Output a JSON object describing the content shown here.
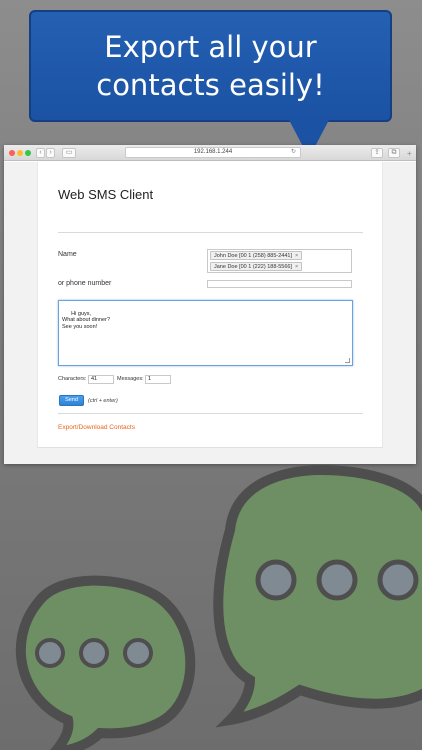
{
  "banner": {
    "line1": "Export all your",
    "line2": "contacts easily!"
  },
  "browser": {
    "url": "192.168.1.244"
  },
  "app": {
    "title": "Web SMS Client",
    "name_label": "Name",
    "recipients": [
      "John Doe [00 1 (258) 885-2441]",
      "Jane Doe [00 1 (222) 188-5566]"
    ],
    "remove_symbol": "×",
    "phone_label": "or phone number",
    "phone_value": "",
    "message": "Hi guys,\nWhat about dinner?\nSee you soon!",
    "characters_label": "Characters:",
    "characters_value": "41",
    "messages_label": "Messages:",
    "messages_value": "1",
    "send_label": "Send",
    "send_hint": "(ctrl + enter)",
    "export_label": "Export/Download Contacts"
  },
  "colors": {
    "banner": "#1b52a3",
    "bubble_fill": "#6e8f63",
    "bubble_outline": "#4e4e4e",
    "link": "#e8641b",
    "send_button": "#2f83d6"
  }
}
